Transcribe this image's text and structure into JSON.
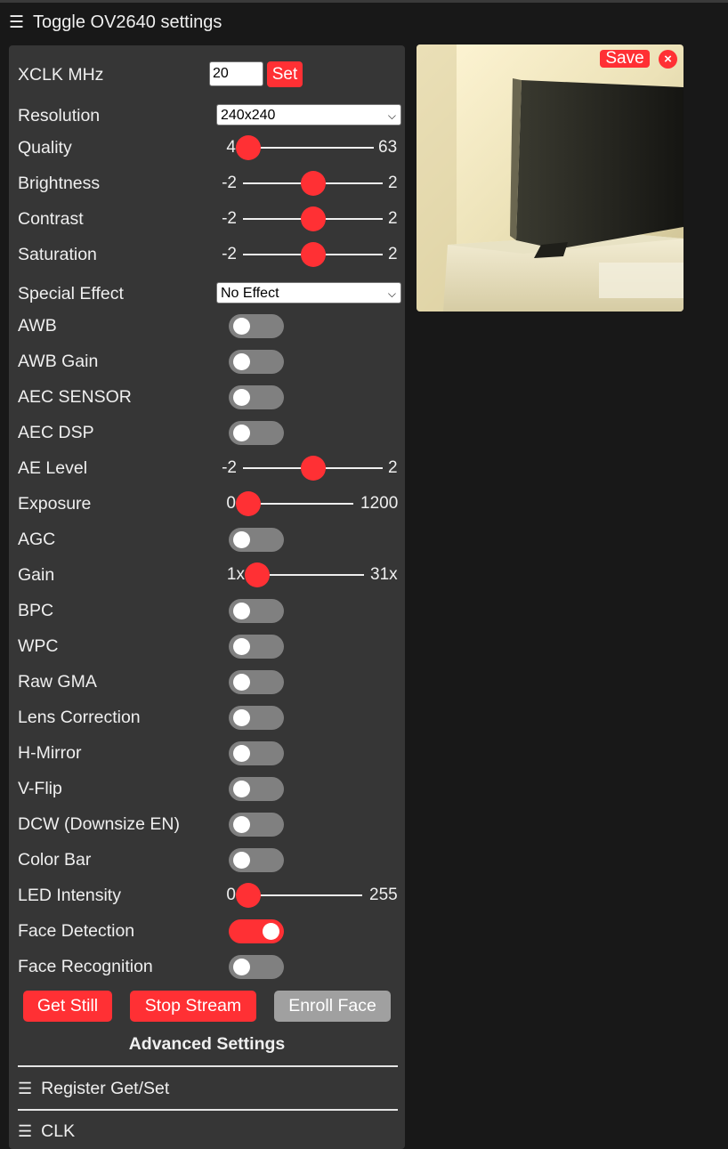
{
  "header": {
    "toggle_icon": "hamburger-icon",
    "title": "Toggle OV2640 settings"
  },
  "xclk": {
    "label": "XCLK MHz",
    "value": "20",
    "set_label": "Set"
  },
  "resolution": {
    "label": "Resolution",
    "value": "240x240"
  },
  "quality": {
    "label": "Quality",
    "min": "4",
    "max": "63",
    "value": 4,
    "range": [
      4,
      63
    ]
  },
  "brightness": {
    "label": "Brightness",
    "min": "-2",
    "max": "2",
    "value": 0,
    "range": [
      -2,
      2
    ]
  },
  "contrast": {
    "label": "Contrast",
    "min": "-2",
    "max": "2",
    "value": 0,
    "range": [
      -2,
      2
    ]
  },
  "saturation": {
    "label": "Saturation",
    "min": "-2",
    "max": "2",
    "value": 0,
    "range": [
      -2,
      2
    ]
  },
  "special_effect": {
    "label": "Special Effect",
    "value": "No Effect"
  },
  "awb": {
    "label": "AWB",
    "on": false
  },
  "awb_gain": {
    "label": "AWB Gain",
    "on": false
  },
  "aec_sensor": {
    "label": "AEC SENSOR",
    "on": false
  },
  "aec_dsp": {
    "label": "AEC DSP",
    "on": false
  },
  "ae_level": {
    "label": "AE Level",
    "min": "-2",
    "max": "2",
    "value": 0,
    "range": [
      -2,
      2
    ]
  },
  "exposure": {
    "label": "Exposure",
    "min": "0",
    "max": "1200",
    "value": 0,
    "range": [
      0,
      1200
    ]
  },
  "agc": {
    "label": "AGC",
    "on": false
  },
  "gain": {
    "label": "Gain",
    "min": "1x",
    "max": "31x",
    "value": 0,
    "range": [
      0,
      30
    ]
  },
  "bpc": {
    "label": "BPC",
    "on": false
  },
  "wpc": {
    "label": "WPC",
    "on": false
  },
  "raw_gma": {
    "label": "Raw GMA",
    "on": false
  },
  "lens_correction": {
    "label": "Lens Correction",
    "on": false
  },
  "h_mirror": {
    "label": "H-Mirror",
    "on": false
  },
  "v_flip": {
    "label": "V-Flip",
    "on": false
  },
  "dcw": {
    "label": "DCW (Downsize EN)",
    "on": false
  },
  "color_bar": {
    "label": "Color Bar",
    "on": false
  },
  "led_intensity": {
    "label": "LED Intensity",
    "min": "0",
    "max": "255",
    "value": 0,
    "range": [
      0,
      255
    ]
  },
  "face_detection": {
    "label": "Face Detection",
    "on": true
  },
  "face_recognition": {
    "label": "Face Recognition",
    "on": false
  },
  "buttons": {
    "get_still": "Get Still",
    "stop_stream": "Stop Stream",
    "enroll_face": "Enroll Face"
  },
  "advanced": {
    "title": "Advanced Settings",
    "register": "Register Get/Set",
    "clk": "CLK"
  },
  "image": {
    "save_label": "Save",
    "close_label": "×"
  },
  "colors": {
    "accent": "#ff3034",
    "panel": "#363636",
    "background": "#181818",
    "switch_off": "#808080"
  }
}
